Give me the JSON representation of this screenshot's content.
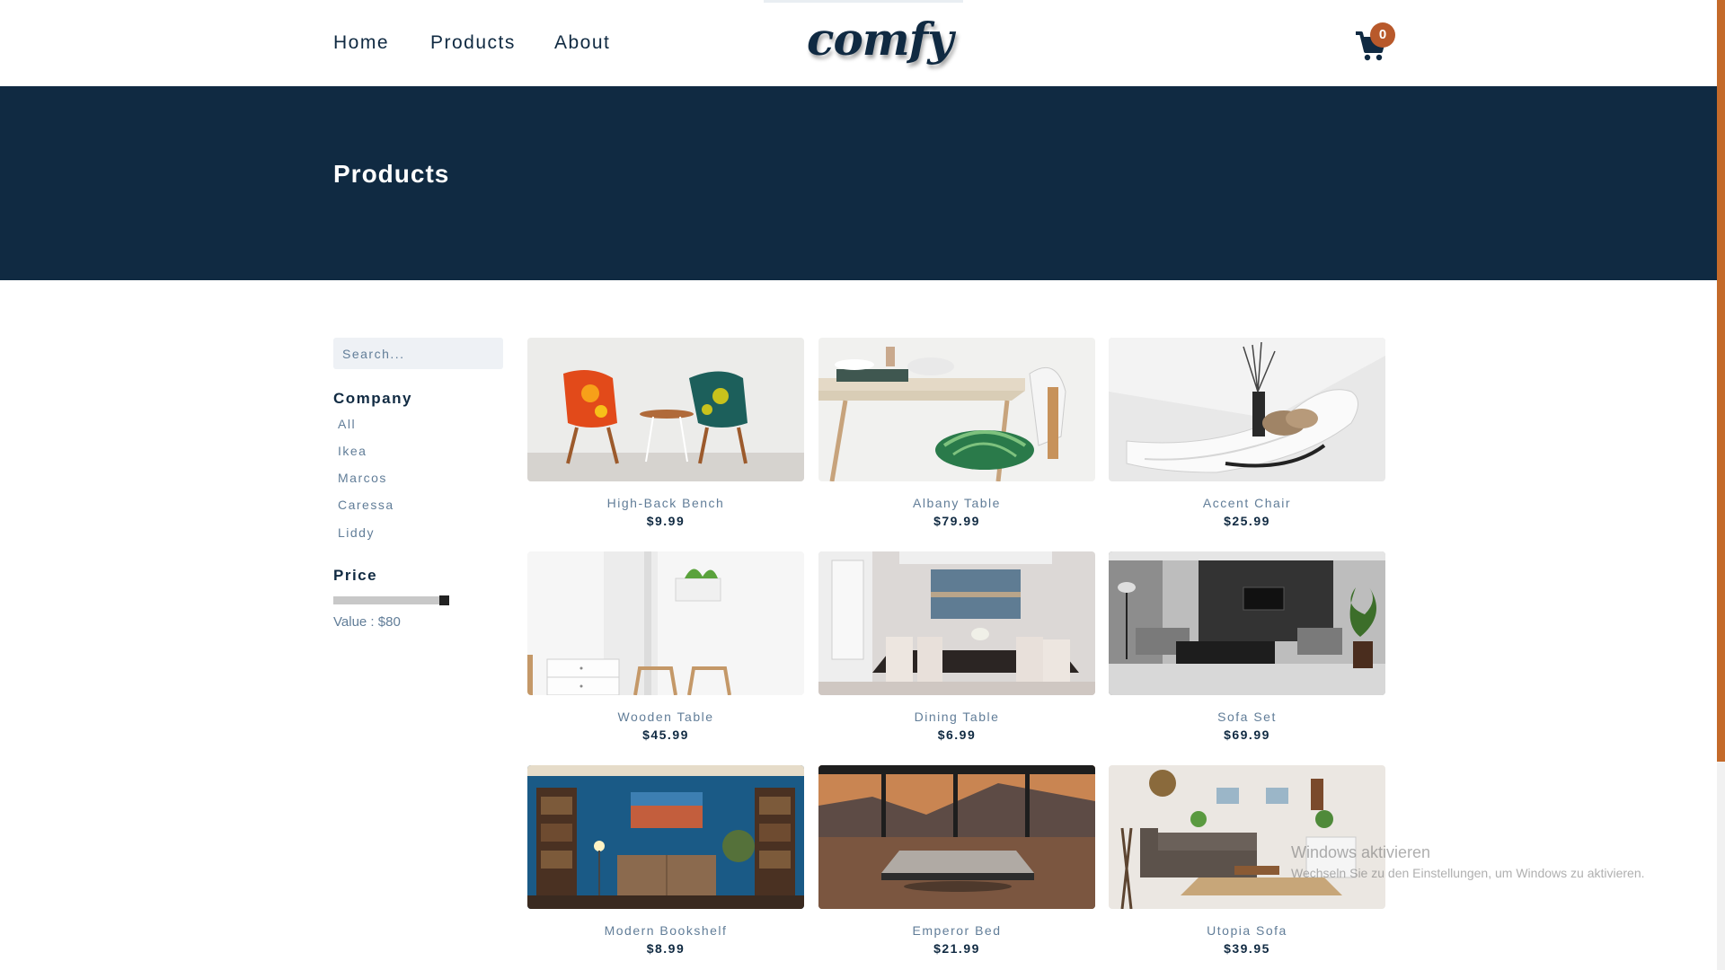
{
  "navbar": {
    "links": [
      "Home",
      "Products",
      "About"
    ],
    "logo": "comfy",
    "cart_count": "0",
    "cart_icon": "shopping-cart-icon"
  },
  "hero": {
    "title": "Products"
  },
  "filters": {
    "search_placeholder": "Search...",
    "company_heading": "Company",
    "companies": [
      "All",
      "Ikea",
      "Marcos",
      "Caressa",
      "Liddy"
    ],
    "price_heading": "Price",
    "price_value": "Value : $80",
    "price_slider_fraction": 1.0
  },
  "products": [
    {
      "name": "High-Back Bench",
      "price": "$9.99"
    },
    {
      "name": "Albany Table",
      "price": "$79.99"
    },
    {
      "name": "Accent Chair",
      "price": "$25.99"
    },
    {
      "name": "Wooden Table",
      "price": "$45.99"
    },
    {
      "name": "Dining Table",
      "price": "$6.99"
    },
    {
      "name": "Sofa Set",
      "price": "$69.99"
    },
    {
      "name": "Modern Bookshelf",
      "price": "$8.99"
    },
    {
      "name": "Emperor Bed",
      "price": "$21.99"
    },
    {
      "name": "Utopia Sofa",
      "price": "$39.95"
    }
  ],
  "watermark": {
    "title": "Windows aktivieren",
    "subtitle": "Wechseln Sie zu den Einstellungen, um Windows zu aktivieren."
  },
  "colors": {
    "primary": "#102a42",
    "accent": "#b8592b",
    "muted_text": "#617d98"
  }
}
